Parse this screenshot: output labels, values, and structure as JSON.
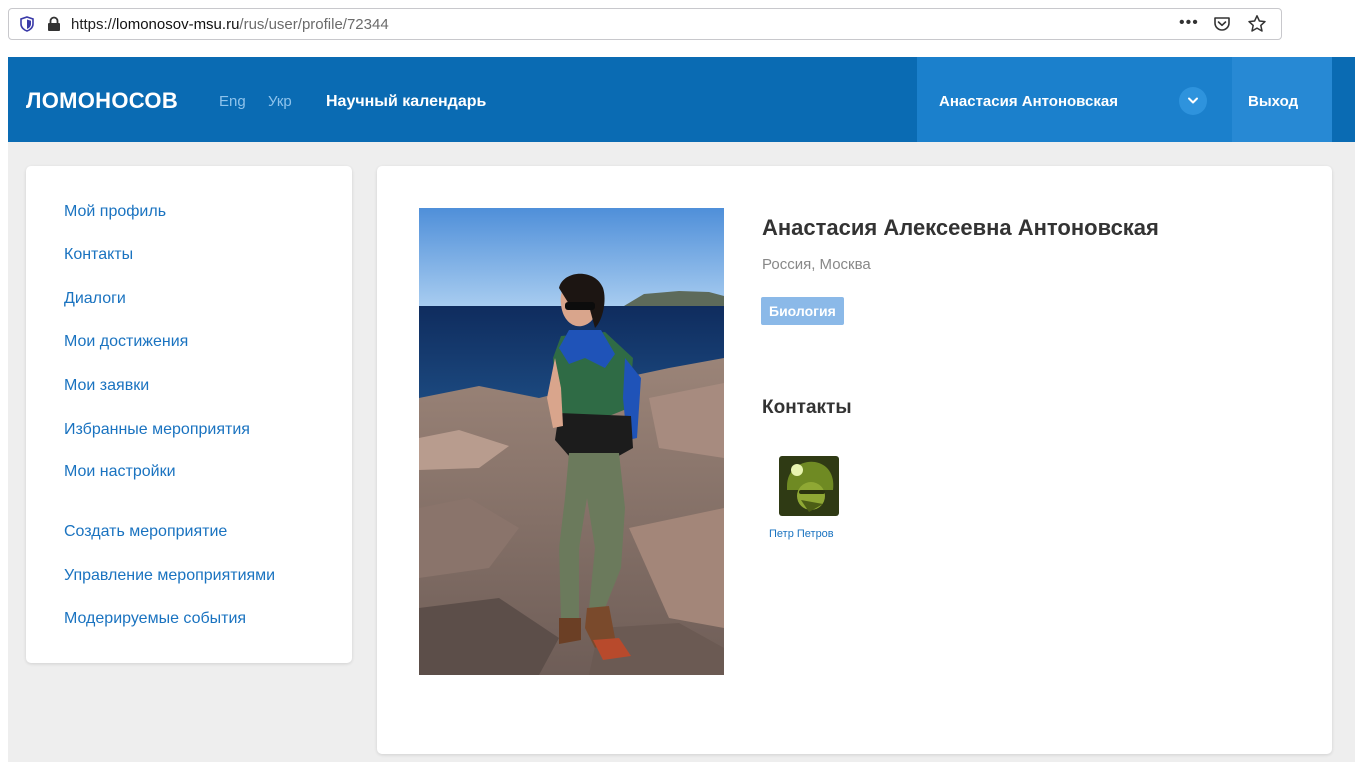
{
  "browser": {
    "url_scheme": "https://",
    "url_host": "lomonosov-msu.ru",
    "url_path": "/rus/user/profile/72344",
    "more_label": "•••"
  },
  "header": {
    "logo": "ЛОМОНОСОВ",
    "lang_eng": "Eng",
    "lang_ukr": "Укр",
    "calendar_link": "Научный календарь",
    "user_name": "Анастасия Антоновская",
    "logout": "Выход"
  },
  "sidebar": {
    "items": [
      {
        "label": "Мой профиль"
      },
      {
        "label": "Контакты"
      },
      {
        "label": "Диалоги"
      },
      {
        "label": "Мои достижения"
      },
      {
        "label": "Мои заявки"
      },
      {
        "label": "Избранные мероприятия"
      },
      {
        "label": "Мои настройки"
      },
      {
        "label": "Создать мероприятие"
      },
      {
        "label": "Управление мероприятиями"
      },
      {
        "label": "Модерируемые события"
      }
    ]
  },
  "profile": {
    "full_name": "Анастасия Алексеевна Антоновская",
    "location": "Россия, Москва",
    "tag": "Биология",
    "contacts_title": "Контакты",
    "contacts": [
      {
        "name": "Петр Петров"
      }
    ]
  },
  "colors": {
    "header_bg": "#0a6bb3",
    "user_area_bg": "#1b80cc",
    "logout_bg": "#2789d4",
    "link": "#1a73c0",
    "tag_bg": "#8bb9e8"
  }
}
